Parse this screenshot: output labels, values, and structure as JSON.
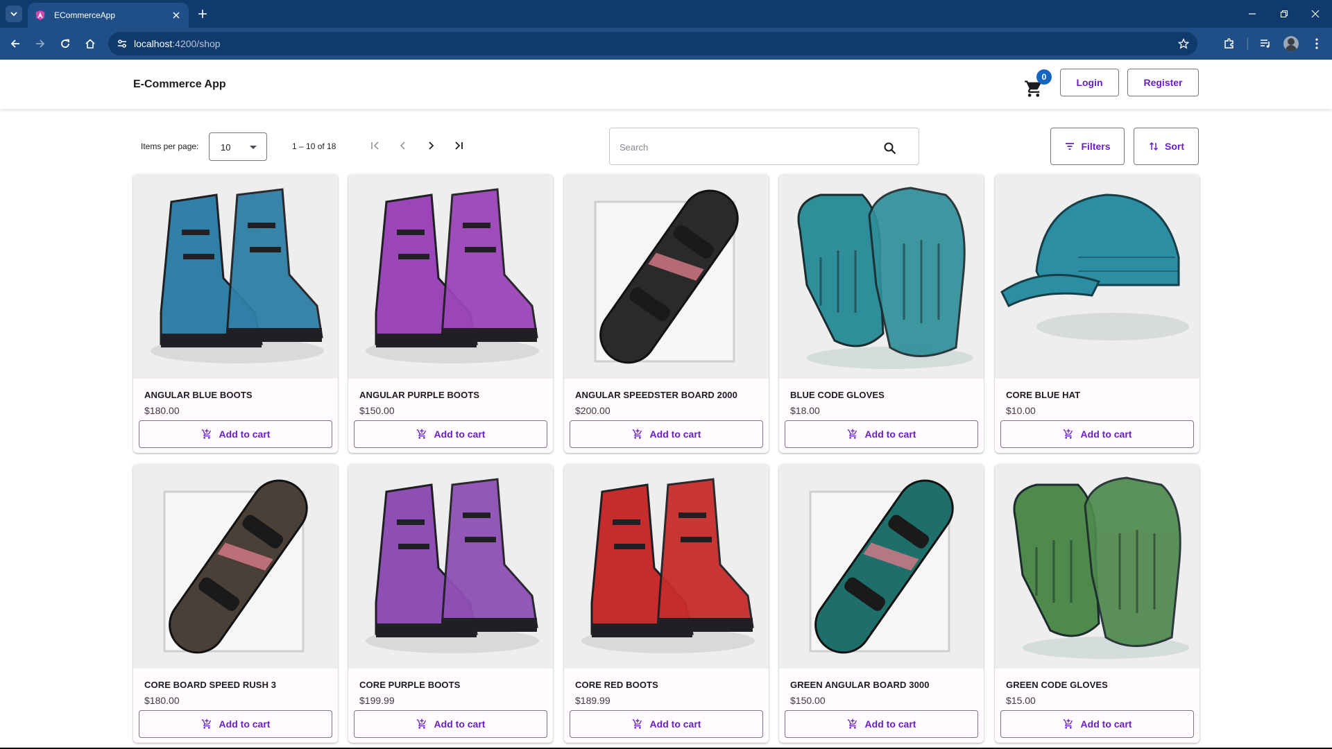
{
  "browser": {
    "tab_title": "ECommerceApp",
    "url_host": "localhost",
    "url_path": ":4200/shop"
  },
  "header": {
    "brand": "E-Commerce App",
    "cart_count": "0",
    "login_label": "Login",
    "register_label": "Register"
  },
  "toolbar": {
    "items_per_page_label": "Items per page:",
    "items_per_page_value": "10",
    "range_label": "1 – 10 of 18",
    "search_placeholder": "Search",
    "filters_label": "Filters",
    "sort_label": "Sort"
  },
  "colors": {
    "accent": "#6a1cc8",
    "browser_frame": "#0f3a6b",
    "badge": "#1565c0"
  },
  "products": [
    {
      "name": "ANGULAR BLUE BOOTS",
      "price": "$180.00",
      "button": "Add to cart",
      "image": "boots",
      "color": "#2f7fa6"
    },
    {
      "name": "ANGULAR PURPLE BOOTS",
      "price": "$150.00",
      "button": "Add to cart",
      "image": "boots",
      "color": "#9a45b8"
    },
    {
      "name": "ANGULAR SPEEDSTER BOARD 2000",
      "price": "$200.00",
      "button": "Add to cart",
      "image": "board",
      "color": "#2a2a2a"
    },
    {
      "name": "BLUE CODE GLOVES",
      "price": "$18.00",
      "button": "Add to cart",
      "image": "gloves",
      "color": "#2e8f9a"
    },
    {
      "name": "CORE BLUE HAT",
      "price": "$10.00",
      "button": "Add to cart",
      "image": "hat",
      "color": "#2b8ea3"
    },
    {
      "name": "CORE BOARD SPEED RUSH 3",
      "price": "$180.00",
      "button": "Add to cart",
      "image": "board",
      "color": "#4a4038"
    },
    {
      "name": "CORE PURPLE BOOTS",
      "price": "$199.99",
      "button": "Add to cart",
      "image": "boots",
      "color": "#8e4fb5"
    },
    {
      "name": "CORE RED BOOTS",
      "price": "$189.99",
      "button": "Add to cart",
      "image": "boots",
      "color": "#c72c2c"
    },
    {
      "name": "GREEN ANGULAR BOARD 3000",
      "price": "$150.00",
      "button": "Add to cart",
      "image": "board",
      "color": "#1e6e6a"
    },
    {
      "name": "GREEN CODE GLOVES",
      "price": "$15.00",
      "button": "Add to cart",
      "image": "gloves",
      "color": "#4f8a4c"
    }
  ]
}
